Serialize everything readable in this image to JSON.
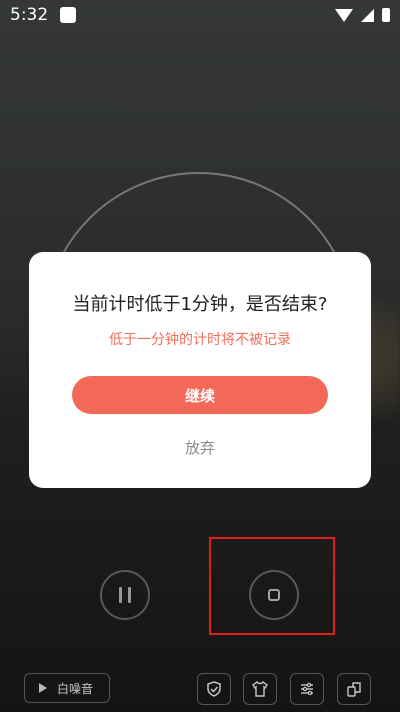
{
  "status_bar": {
    "time": "5:32"
  },
  "dialog": {
    "title": "当前计时低于1分钟，是否结束?",
    "subtitle": "低于一分钟的计时将不被记录",
    "continue_label": "继续",
    "giveup_label": "放弃"
  },
  "bottom_bar": {
    "white_noise_label": "白噪音"
  },
  "colors": {
    "accent": "#f26a57",
    "subtitle": "#f0705a",
    "highlight": "#e01e1e"
  }
}
